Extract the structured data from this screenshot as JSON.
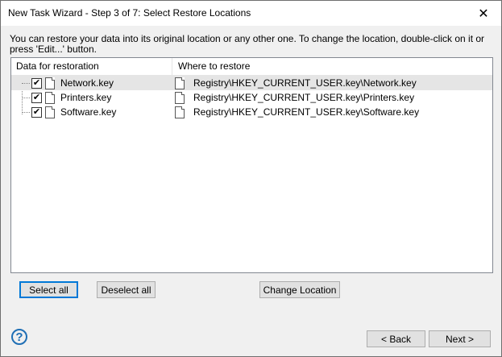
{
  "window": {
    "title": "New Task Wizard - Step 3 of 7: Select Restore Locations",
    "close_glyph": "✕"
  },
  "instructions": "You can restore your data into its original location or any other one. To change the location, double-click on it or press 'Edit...' button.",
  "list": {
    "columns": [
      "Data for restoration",
      "Where to restore"
    ],
    "rows": [
      {
        "name": "Network.key",
        "checked": "✔",
        "location": "Registry\\HKEY_CURRENT_USER.key\\Network.key"
      },
      {
        "name": "Printers.key",
        "checked": "✔",
        "location": "Registry\\HKEY_CURRENT_USER.key\\Printers.key"
      },
      {
        "name": "Software.key",
        "checked": "✔",
        "location": "Registry\\HKEY_CURRENT_USER.key\\Software.key"
      }
    ]
  },
  "buttons": {
    "select_all": "Select all",
    "deselect_all": "Deselect all",
    "change_location": "Change Location",
    "back": "< Back",
    "next": "Next >"
  },
  "help_glyph": "?"
}
